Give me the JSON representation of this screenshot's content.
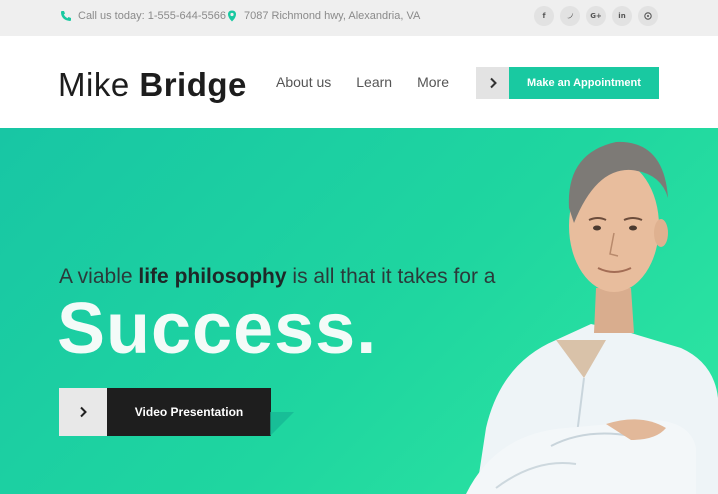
{
  "topbar": {
    "phone": "Call us today: 1-555-644-5566",
    "address": "7087 Richmond hwy, Alexandria, VA",
    "socials": [
      {
        "icon": "facebook-icon",
        "glyph": "f"
      },
      {
        "icon": "twitter-icon",
        "glyph": "❧"
      },
      {
        "icon": "google-plus-icon",
        "glyph": "G+"
      },
      {
        "icon": "linkedin-icon",
        "glyph": "in"
      },
      {
        "icon": "pinterest-icon",
        "glyph": "℗"
      }
    ]
  },
  "header": {
    "logo_first": "Mike",
    "logo_last": "Bridge",
    "nav": [
      "About us",
      "Learn",
      "More"
    ],
    "cta": "Make an Appointment"
  },
  "hero": {
    "tagline_before": "A viable ",
    "tagline_bold": "life philosophy",
    "tagline_after": " is all that it takes for a",
    "headline": "Success.",
    "video_button": "Video Presentation"
  },
  "colors": {
    "accent": "#19c9a1",
    "hero_gradient_start": "#18c6a4",
    "hero_gradient_end": "#2fe7a2",
    "dark_button": "#1e1e1e"
  }
}
